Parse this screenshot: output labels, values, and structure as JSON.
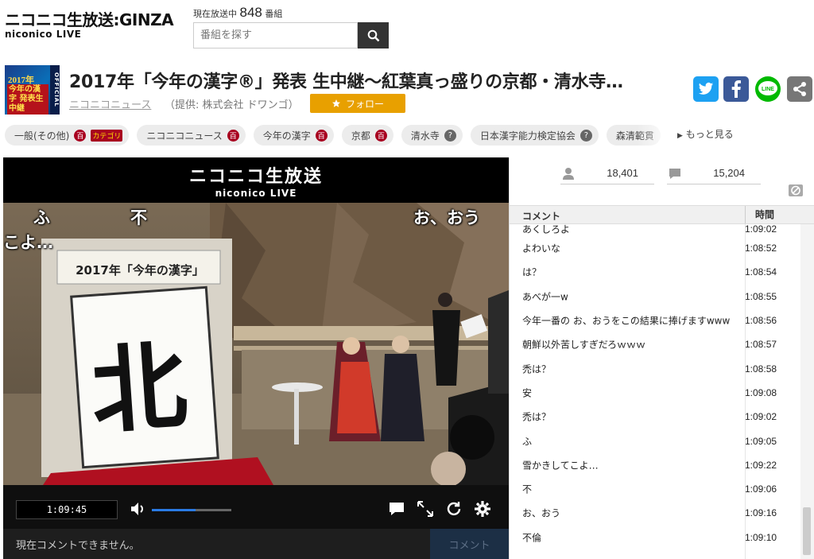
{
  "header": {
    "logo_top": "ニコニコ生放送:GINZA",
    "logo_sub": "niconico LIVE",
    "onair_prefix": "現在放送中",
    "onair_count": "848",
    "onair_suffix": "番組",
    "search_placeholder": "番組を探す"
  },
  "program": {
    "thumb_line1": "2017年",
    "thumb_line2": "今年の漢字 発表生中継",
    "thumb_official": "OFFICIAL",
    "title": "2017年「今年の漢字®」発表 生中継～紅葉真っ盛りの京都・清水寺…",
    "channel": "ニコニコニュース",
    "provider": "（提供: 株式会社 ドワンゴ）",
    "follow_label": "フォロー",
    "share": {
      "line_label": "LINE"
    }
  },
  "tags": [
    {
      "label": "一般(その他)",
      "badges": [
        "dic",
        "cat"
      ]
    },
    {
      "label": "ニコニコニュース",
      "badges": [
        "dic"
      ]
    },
    {
      "label": "今年の漢字",
      "badges": [
        "dic"
      ]
    },
    {
      "label": "京都",
      "badges": [
        "dic"
      ]
    },
    {
      "label": "清水寺",
      "badges": [
        "q"
      ]
    },
    {
      "label": "日本漢字能力検定協会",
      "badges": [
        "q"
      ]
    },
    {
      "label": "森清範貫",
      "badges": []
    }
  ],
  "tag_badges": {
    "dic": "百",
    "cat": "カテゴリ",
    "q": "?"
  },
  "more_tags": "もっと見る",
  "player": {
    "logo_a": "ニコニコ生放送",
    "logo_b": "niconico LIVE",
    "sign_line": "2017年「今年の漢字」",
    "big_kanji": "北",
    "danmaku": [
      "ふ",
      "不",
      "お、おう",
      "こよ…"
    ],
    "current_time": "1:09:45",
    "volume_level": 0.55,
    "comment_placeholder": "現在コメントできません。",
    "comment_button": "コメント",
    "icons": [
      "volume-icon",
      "comment-toggle-icon",
      "fullscreen-icon",
      "reload-icon",
      "settings-icon"
    ]
  },
  "panel": {
    "viewers": "18,401",
    "comments_count": "15,204",
    "col_comment": "コメント",
    "col_time": "時間",
    "rows": [
      {
        "text": "あくしろよ",
        "time": "1:09:02"
      },
      {
        "text": "よわいな",
        "time": "1:08:52"
      },
      {
        "text": "は？",
        "time": "1:08:54"
      },
      {
        "text": "あべが一w",
        "time": "1:08:55"
      },
      {
        "text": "今年一番の お、おうをこの結果に捧げますwww",
        "time": "1:08:56"
      },
      {
        "text": "朝鮮以外苦しすぎだろｗｗｗ",
        "time": "1:08:57"
      },
      {
        "text": "禿は？",
        "time": "1:08:58"
      },
      {
        "text": "安",
        "time": "1:09:08"
      },
      {
        "text": "禿は？",
        "time": "1:09:02"
      },
      {
        "text": "ふ",
        "time": "1:09:05"
      },
      {
        "text": "雪かきしてこよ…",
        "time": "1:09:22"
      },
      {
        "text": "不",
        "time": "1:09:06"
      },
      {
        "text": "お、おう",
        "time": "1:09:16"
      },
      {
        "text": "不倫",
        "time": "1:09:10"
      }
    ]
  },
  "colors": {
    "follow": "#e8a000",
    "twitter": "#1da1f2",
    "facebook": "#3b5998",
    "line": "#00b900",
    "badge_red": "#a8001f",
    "volume": "#2a7be4"
  }
}
